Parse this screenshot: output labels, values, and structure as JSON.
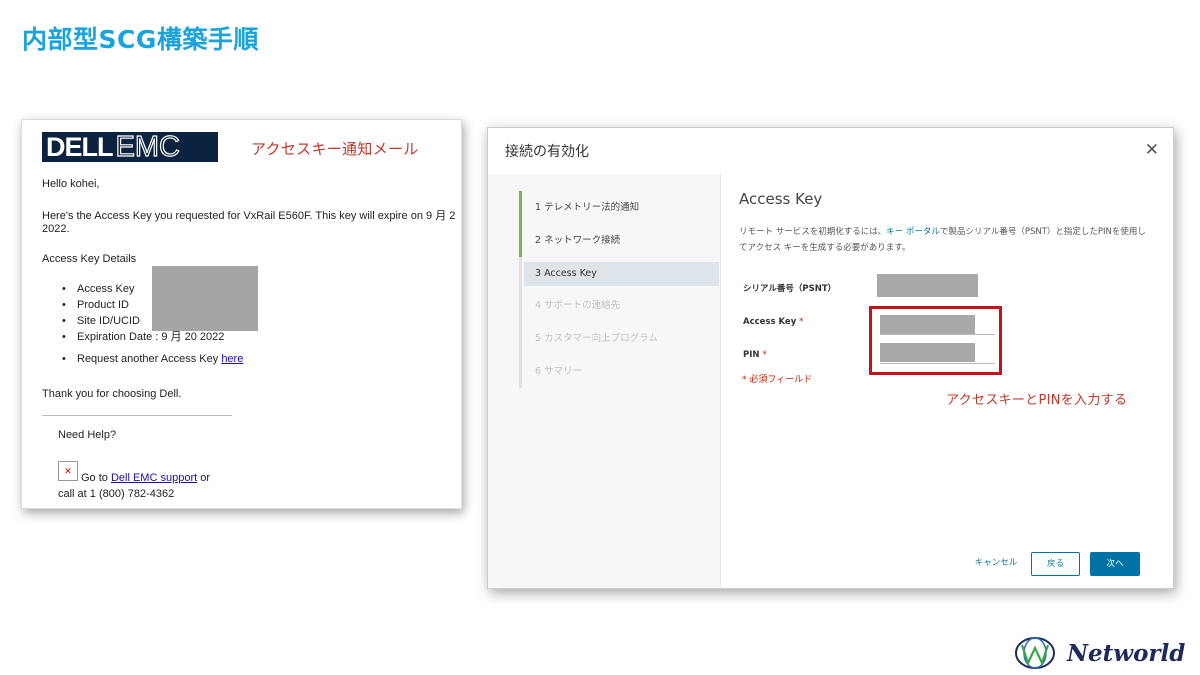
{
  "slide": {
    "title": "内部型SCG構築手順"
  },
  "email": {
    "logo": {
      "dell": "DELL",
      "emc": "EMC"
    },
    "annotation": "アクセスキー通知メール",
    "greeting": "Hello kohei,",
    "intro_line1": "Here's the Access Key you requested for VxRail E560F. This key will expire on 9 月 2",
    "intro_line2": "2022.",
    "details_heading": "Access Key Details",
    "items": [
      "Access Key",
      "Product ID",
      "Site ID/UCID",
      "Expiration Date : 9 月 20 2022"
    ],
    "request_text": "Request another Access Key ",
    "request_link": "here",
    "thanks": "Thank you for choosing Dell.",
    "need_help": "Need Help?",
    "go_to": "Go to ",
    "support_link": "Dell EMC support",
    "or": " or",
    "call": "call at 1 (800) 782-4362"
  },
  "dialog": {
    "title": "接続の有効化",
    "close_icon": "close-icon",
    "steps": [
      {
        "label": "1  テレメトリー法的通知",
        "state": "done"
      },
      {
        "label": "2  ネットワーク接続",
        "state": "done"
      },
      {
        "label": "3  Access Key",
        "state": "active"
      },
      {
        "label": "4  サポートの連絡先",
        "state": "disabled"
      },
      {
        "label": "5  カスタマー向上プログラム",
        "state": "disabled"
      },
      {
        "label": "6  サマリー",
        "state": "disabled"
      }
    ],
    "heading": "Access Key",
    "desc_part1": "リモート サービスを初期化するには、",
    "desc_link": "キー ポータル",
    "desc_part2": "で製品シリアル番号（PSNT）と指定したPINを使用してアクセス キーを生成する必要があります。",
    "serial_label": "シリアル番号（PSNT）",
    "access_key_label": "Access Key",
    "pin_label": "PIN",
    "required_mark": "*",
    "required_note": "* 必須フィールド",
    "annotation": "アクセスキーとPINを入力する",
    "buttons": {
      "cancel": "キャンセル",
      "back": "戻る",
      "next": "次へ"
    }
  },
  "footer": {
    "brand": "Networld"
  },
  "colors": {
    "title": "#1aa3dc",
    "annotation": "#c0392b",
    "accent": "#0072a3",
    "progress": "#7ab648"
  }
}
